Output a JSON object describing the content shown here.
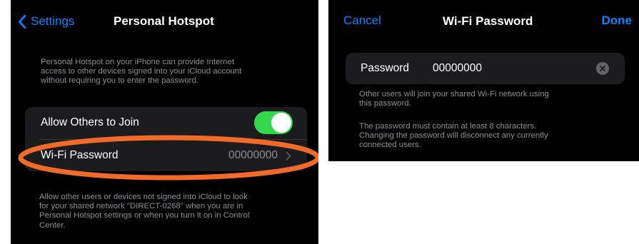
{
  "hotspot": {
    "back_label": "Settings",
    "title": "Personal Hotspot",
    "intro_lines": [
      "Personal Hotspot on your iPhone can provide Internet",
      "access to other devices signed into your iCloud account",
      "without requiring you to enter the password."
    ],
    "allow_label": "Allow Others to Join",
    "allow_enabled": true,
    "wifi_label": "Wi-Fi Password",
    "wifi_value": "00000000",
    "footer_lines": [
      "Allow other users or devices not signed into iCloud to look",
      "for your shared network \"DIRECT-0268\" when you are in",
      "Personal Hotspot settings or when you turn it on in Control",
      "Center."
    ]
  },
  "wifi_password": {
    "cancel_label": "Cancel",
    "title": "Wi-Fi Password",
    "done_label": "Done",
    "field_label": "Password",
    "field_value": "00000000",
    "note1_lines": [
      "Other users will join your shared Wi-Fi network using",
      "this password."
    ],
    "note2_lines": [
      "The password must contain at least 8 characters.",
      "Changing the password will disconnect any currently",
      "connected users."
    ]
  },
  "colors": {
    "accent": "#0a84ff",
    "toggle_on": "#32d74b",
    "highlight": "#f26a2a",
    "background": "#000000",
    "cell": "#1c1c1e",
    "secondary_text": "#8d8d93"
  }
}
